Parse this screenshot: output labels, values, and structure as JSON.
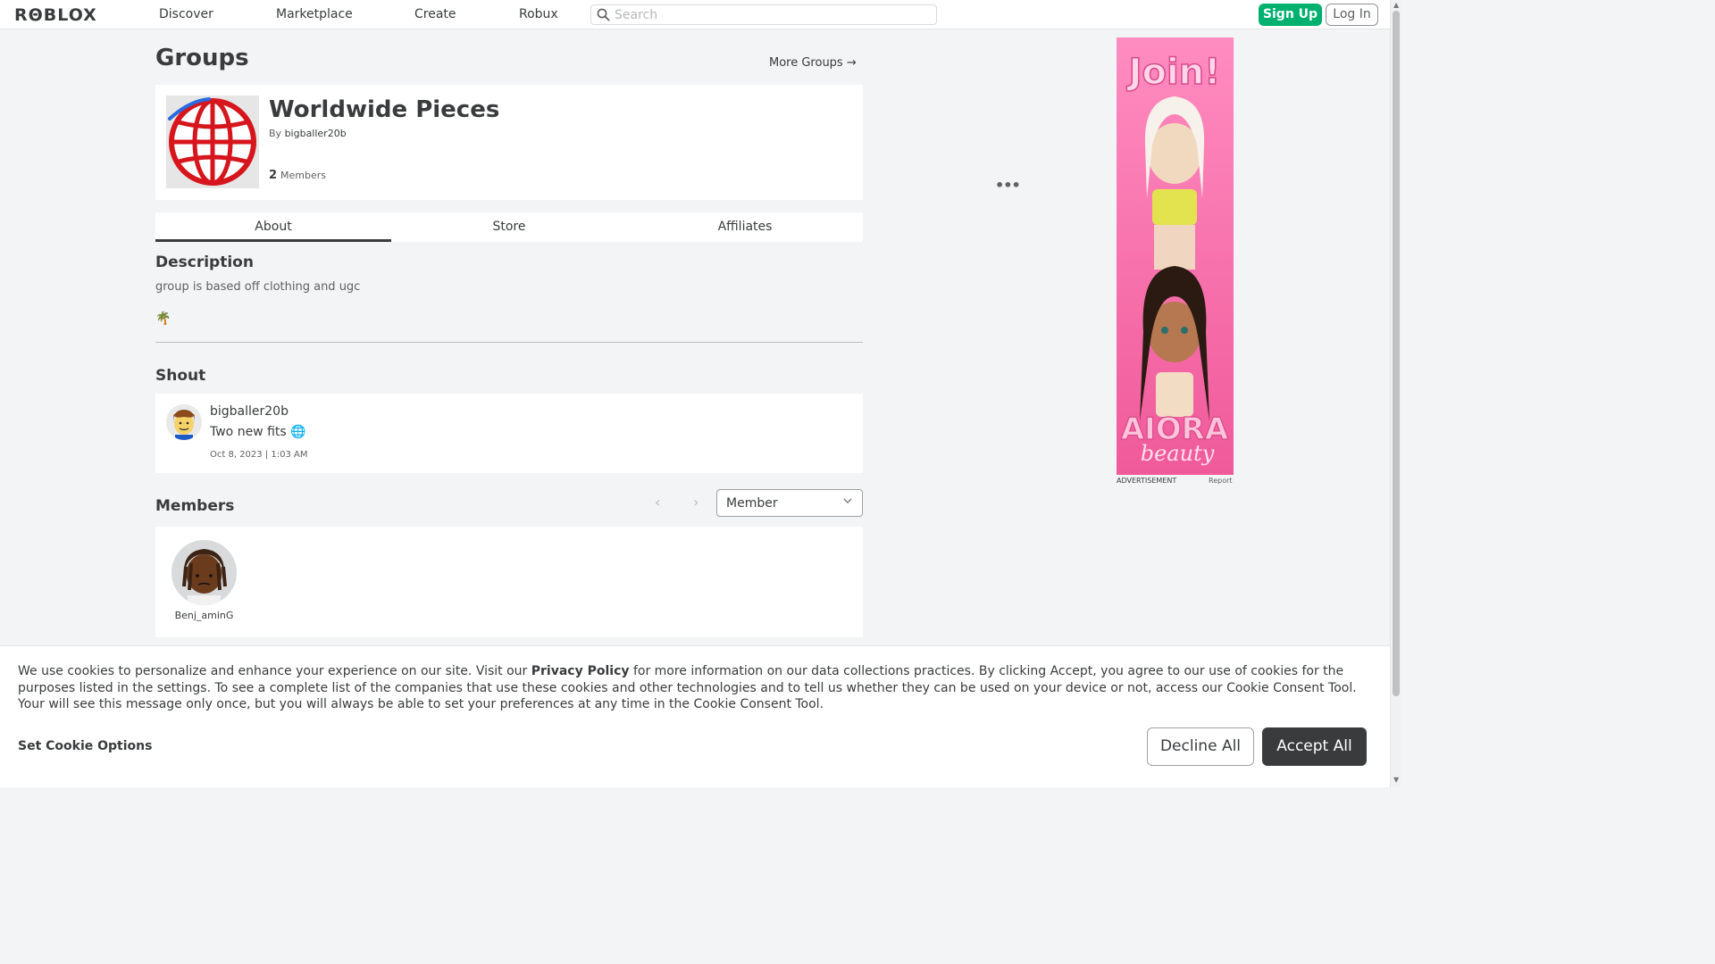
{
  "header": {
    "logo": "RΘBLOX",
    "nav": [
      "Discover",
      "Marketplace",
      "Create",
      "Robux"
    ],
    "search_placeholder": "Search",
    "signup_label": "Sign Up",
    "login_label": "Log In"
  },
  "page": {
    "title": "Groups",
    "more_groups": "More Groups →"
  },
  "group": {
    "name": "Worldwide Pieces",
    "by_label": "By",
    "owner": "bigballer20b",
    "member_count": "2",
    "members_label": "Members",
    "menu_icon": "ellipsis-icon"
  },
  "tabs": [
    "About",
    "Store",
    "Affiliates"
  ],
  "about": {
    "description_heading": "Description",
    "description": "group is based off clothing and ugc",
    "emoji": "🌴"
  },
  "shout": {
    "heading": "Shout",
    "user": "bigballer20b",
    "message": "Two new fits",
    "emoji": "🌐",
    "date": "Oct 8, 2023 | 1:03 AM"
  },
  "members": {
    "heading": "Members",
    "role_select": "Member",
    "list": [
      {
        "name": "Benj_aminG"
      }
    ]
  },
  "ad": {
    "label": "ADVERTISEMENT",
    "report": "Report",
    "headline": "Join!",
    "brand": "AIORA",
    "brand_sub": "beauty"
  },
  "cookie": {
    "text_before": "We use cookies to personalize and enhance your experience on our site. Visit our ",
    "privacy_link": "Privacy Policy",
    "text_after": " for more information on our data collections practices. By clicking Accept, you agree to our use of cookies for the purposes listed in the settings. To see a complete list of the companies that use these cookies and other technologies and to tell us whether they can be used on your device or not, access our Cookie Consent Tool. Your will see this message only once, but you will always be able to set your preferences at any time in the Cookie Consent Tool.",
    "set_options": "Set Cookie Options",
    "decline": "Decline All",
    "accept": "Accept All"
  },
  "colors": {
    "accent_green": "#00b06f",
    "dark_button": "#393b3d",
    "ad_pink": "#f36ca6"
  }
}
